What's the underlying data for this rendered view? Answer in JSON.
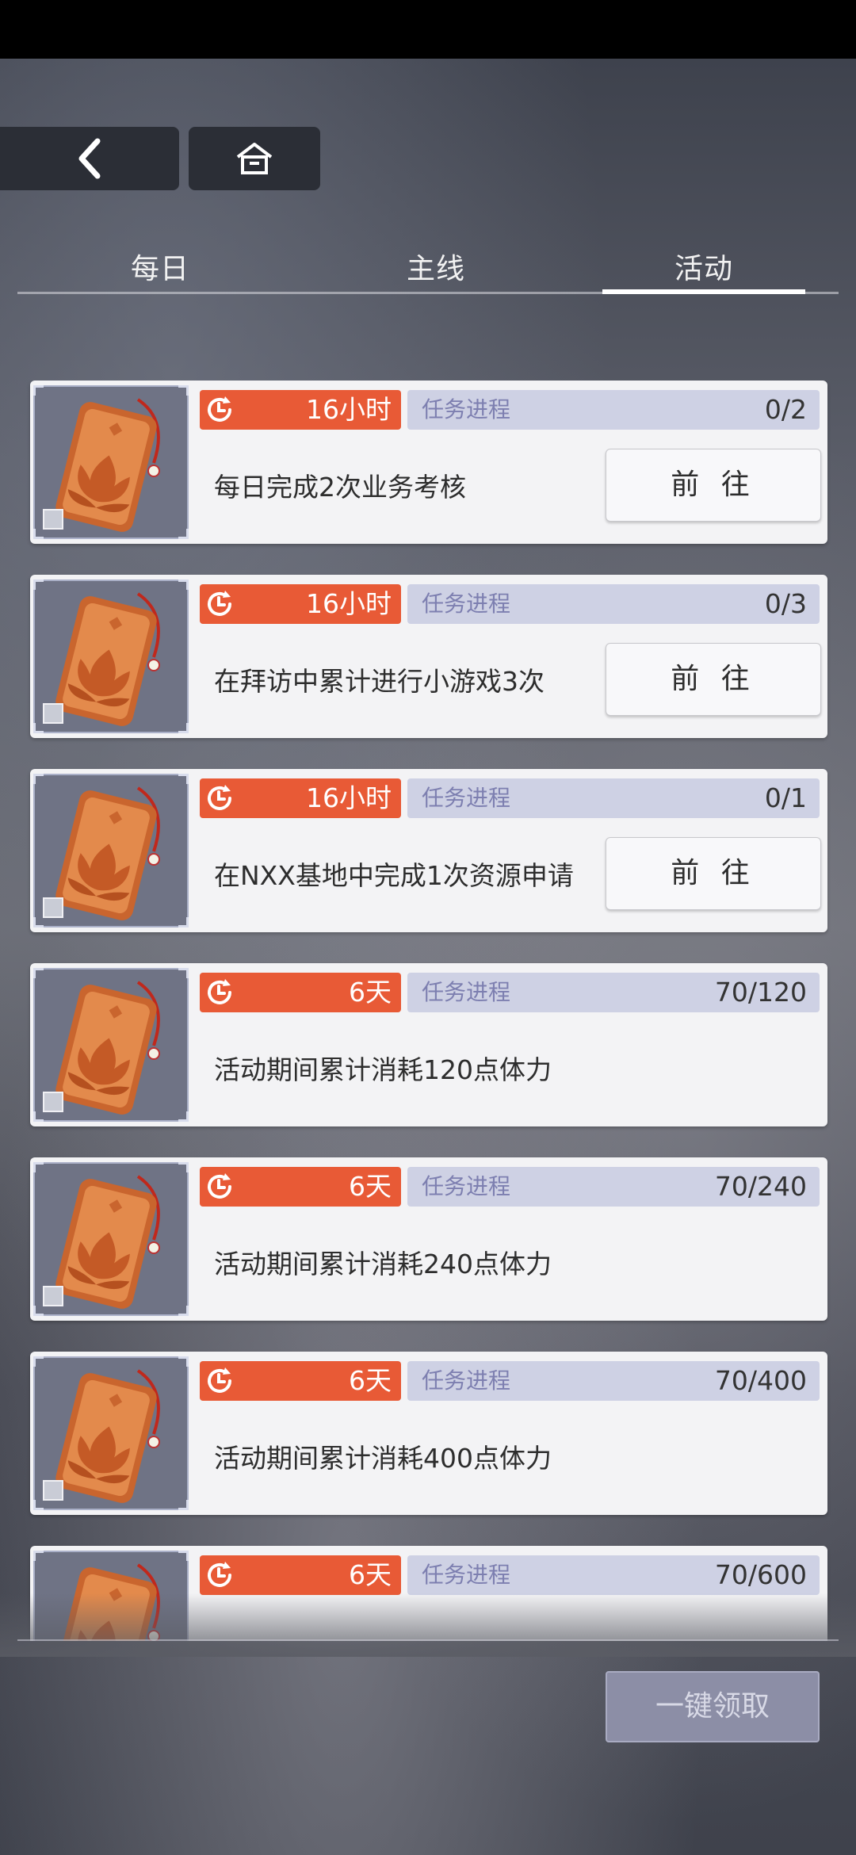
{
  "nav": {
    "back_icon": "chevron-left-icon",
    "home_icon": "home-icon"
  },
  "tabs": [
    {
      "label": "每日",
      "active": false
    },
    {
      "label": "主线",
      "active": false
    },
    {
      "label": "活动",
      "active": true
    }
  ],
  "progress_label": "任务进程",
  "go_label": "前 往",
  "tasks": [
    {
      "timer": "16小时",
      "progress": "0/2",
      "desc": "每日完成2次业务考核",
      "has_go": true
    },
    {
      "timer": "16小时",
      "progress": "0/3",
      "desc": "在拜访中累计进行小游戏3次",
      "has_go": true
    },
    {
      "timer": "16小时",
      "progress": "0/1",
      "desc": "在NXX基地中完成1次资源申请",
      "has_go": true
    },
    {
      "timer": "6天",
      "progress": "70/120",
      "desc": "活动期间累计消耗120点体力",
      "has_go": false
    },
    {
      "timer": "6天",
      "progress": "70/240",
      "desc": "活动期间累计消耗240点体力",
      "has_go": false
    },
    {
      "timer": "6天",
      "progress": "70/400",
      "desc": "活动期间累计消耗400点体力",
      "has_go": false
    },
    {
      "timer": "6天",
      "progress": "70/600",
      "desc": "",
      "has_go": false
    }
  ],
  "claim_all_label": "一键领取",
  "colors": {
    "timer_bg": "#e85a36",
    "progress_bg": "#ced1e4",
    "progress_label": "#7d7fb0"
  }
}
